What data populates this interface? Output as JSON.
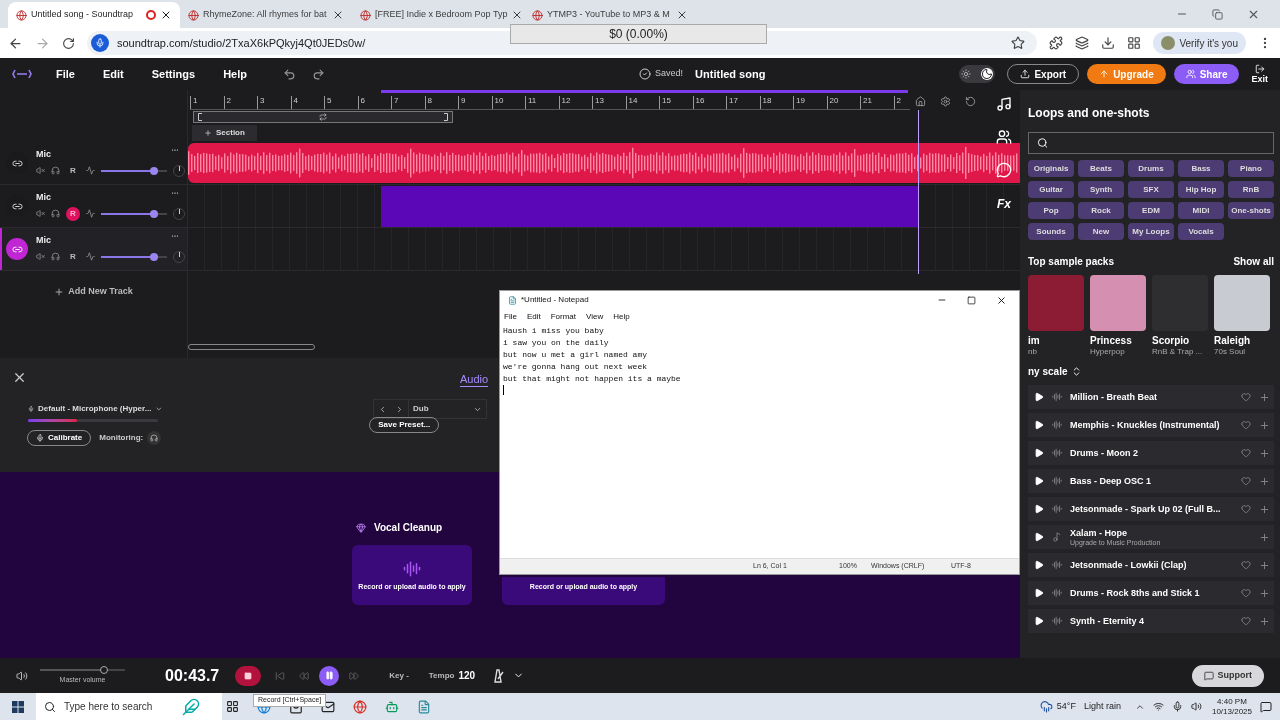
{
  "browser": {
    "tabs": [
      {
        "title": "Untitled song - Soundtrap",
        "selected": true,
        "recording": true
      },
      {
        "title": "RhymeZone: All rhymes for bat",
        "selected": false,
        "recording": false
      },
      {
        "title": "[FREE] Indie x Bedroom Pop Typ",
        "selected": false,
        "recording": false
      },
      {
        "title": "YTMP3 - YouTube to MP3 & M",
        "selected": false,
        "recording": false
      }
    ],
    "url": "soundtrap.com/studio/2TxaX6kPQkyj4Qt0JEDs0w/",
    "profile": "Verify it's you",
    "overlay": "$0 (0.00%)"
  },
  "app": {
    "dark_mode": true,
    "menu": [
      "File",
      "Edit",
      "Settings",
      "Help"
    ],
    "status": "Saved!",
    "song_title": "Untitled song",
    "buttons": [
      {
        "label": "Export",
        "kind": "export"
      },
      {
        "label": "Upgrade",
        "kind": "upgrade"
      },
      {
        "label": "Share",
        "kind": "share"
      }
    ],
    "exit": "Exit"
  },
  "ruler": [
    "1",
    "2",
    "3",
    "4",
    "5",
    "6",
    "7",
    "8",
    "9",
    "10",
    "11",
    "12",
    "13",
    "14",
    "15",
    "16",
    "17",
    "18",
    "19",
    "20",
    "21",
    "2"
  ],
  "section_button": "Section",
  "tracks": [
    {
      "name": "Mic",
      "record_label": "R",
      "armed": false,
      "selected": false,
      "level": 0.8,
      "kind": "audio"
    },
    {
      "name": "Mic",
      "record_label": "R",
      "armed": true,
      "selected": false,
      "level": 0.8,
      "kind": "recording"
    },
    {
      "name": "Mic",
      "record_label": "R",
      "armed": false,
      "selected": true,
      "level": 0.8,
      "kind": "empty"
    }
  ],
  "effects_button": "Fx",
  "add_track": "Add New Track",
  "recorder": {
    "tab": {
      "label": "Audio",
      "selected": true
    },
    "input": "Default - Microphone (Hyper...",
    "input_meter": {
      "level": 0.38
    },
    "calibrate": "Calibrate",
    "monitoring": "Monitoring:",
    "preset": "Dub",
    "save_preset": "Save Preset...",
    "effect_title": "Vocal Cleanup",
    "cards": [
      "Record or upload audio to apply",
      "Record or upload audio to apply"
    ]
  },
  "transport": {
    "master_label": "Master volume",
    "master_volume": {
      "level": 0.75
    },
    "time": "00:43.7",
    "recording": true,
    "playing": true,
    "key": "Key -",
    "tempo_label": "Tempo",
    "tempo": "120",
    "tooltip": "Record [Ctrl+Space]",
    "support": "Support"
  },
  "loops": {
    "title": "Loops and one-shots",
    "categories": [
      "Originals",
      "Beats",
      "Drums",
      "Bass",
      "Piano",
      "Guitar",
      "Synth",
      "SFX",
      "Hip Hop",
      "RnB",
      "Pop",
      "Rock",
      "EDM",
      "MIDI",
      "One-shots",
      "Sounds",
      "New",
      "My Loops",
      "Vocals"
    ],
    "packs_title": "Top sample packs",
    "show_all": "Show all",
    "packs": [
      {
        "name": "im",
        "genre": "nb",
        "color": "#8c1c34"
      },
      {
        "name": "Princess",
        "genre": "Hyperpop",
        "color": "#d58fb0"
      },
      {
        "name": "Scorpio",
        "genre": "RnB & Trap ...",
        "color": "#2e2e30"
      },
      {
        "name": "Raleigh",
        "genre": "70s Soul",
        "color": "#c9cbd2"
      }
    ],
    "scale": "ny scale",
    "items": [
      {
        "kind": "loop",
        "title": "Million - Breath Beat"
      },
      {
        "kind": "loop",
        "title": "Memphis - Knuckles (Instrumental)"
      },
      {
        "kind": "loop",
        "title": "Drums - Moon 2"
      },
      {
        "kind": "loop",
        "title": "Bass - Deep OSC 1"
      },
      {
        "kind": "loop",
        "title": "Jetsonmade - Spark Up 02 (Full B..."
      },
      {
        "kind": "locked",
        "title": "Xalam - Hope",
        "note": "Upgrade to Music Production"
      },
      {
        "kind": "loop",
        "title": "Jetsonmade - Lowkii (Clap)"
      },
      {
        "kind": "loop",
        "title": "Drums - Rock 8ths and Stick 1"
      },
      {
        "kind": "loop",
        "title": "Synth - Eternity 4"
      }
    ]
  },
  "notepad": {
    "title": "*Untitled - Notepad",
    "menu": [
      "File",
      "Edit",
      "Format",
      "View",
      "Help"
    ],
    "lines": [
      "Haush i miss you baby",
      "i saw you on the daily",
      "but now u met a girl named amy",
      "we're gonna hang out next week",
      "but that might not happen its a maybe"
    ],
    "status": [
      "Ln 6, Col 1",
      "100%",
      "Windows (CRLF)",
      "UTF-8"
    ]
  },
  "taskbar": {
    "search": {
      "placeholder": "Type here to search"
    },
    "weather": "54°F",
    "weather_text": "Light rain",
    "time": "4:40 PM",
    "date": "10/13/2025"
  }
}
